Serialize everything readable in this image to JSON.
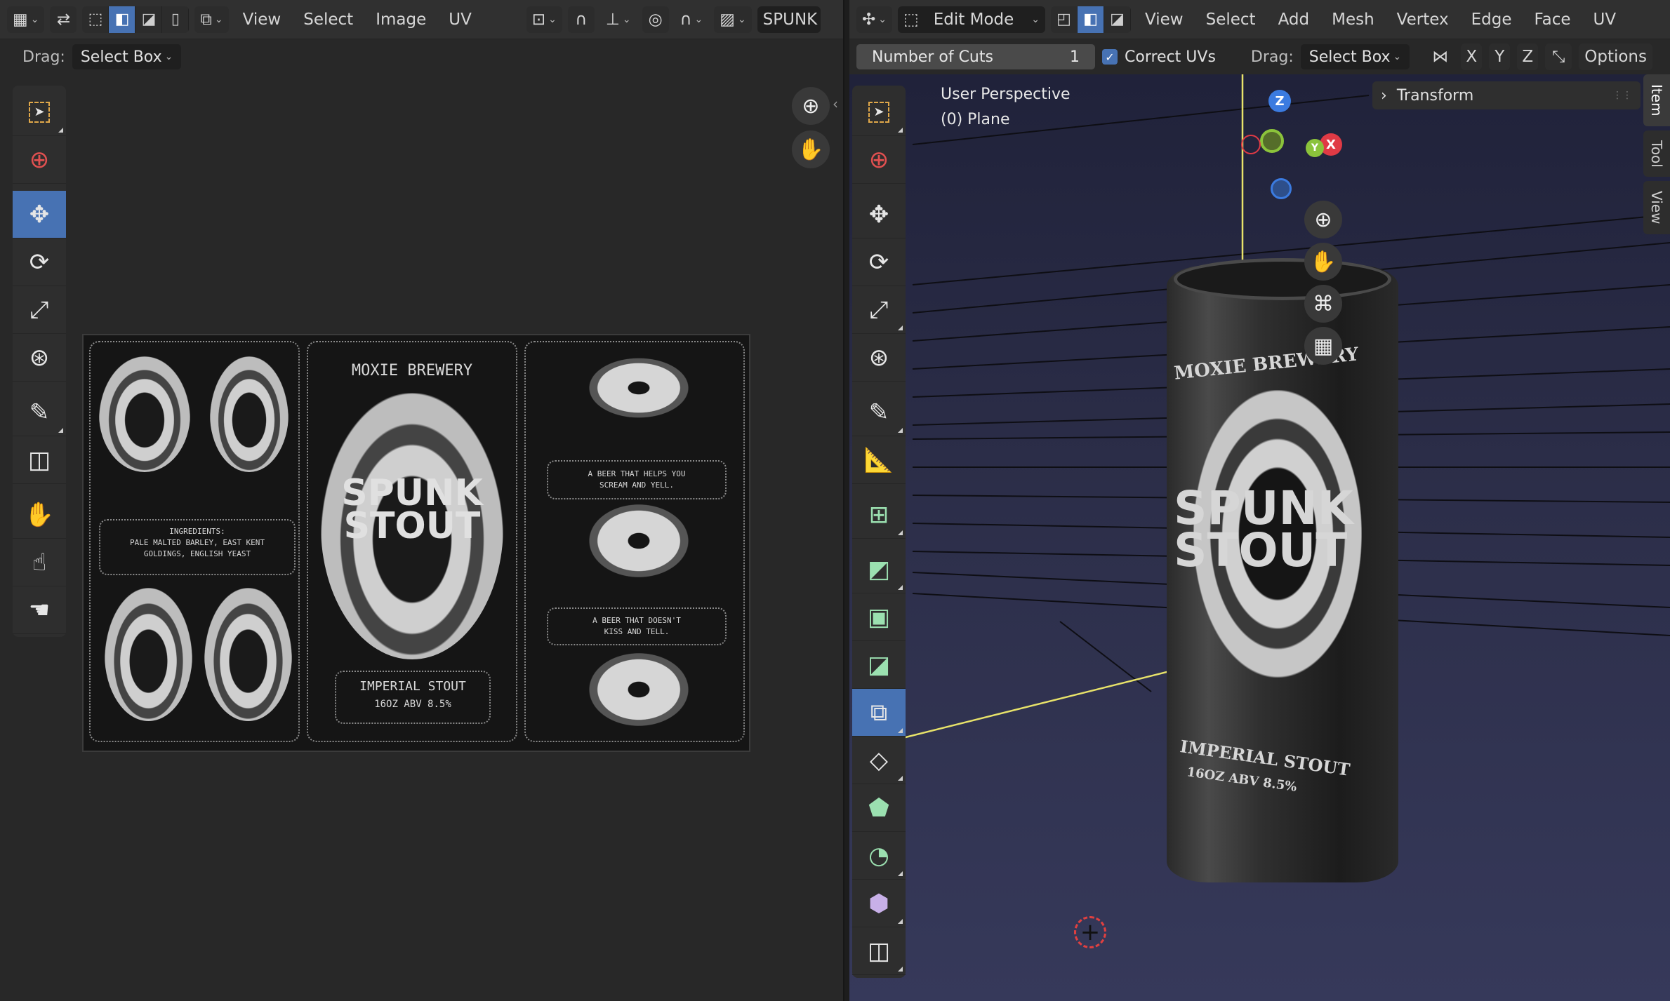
{
  "uv_editor": {
    "menus": [
      "View",
      "Select",
      "Image",
      "UV"
    ],
    "image_name": "SPUNK",
    "drag_label": "Drag:",
    "drag_value": "Select Box"
  },
  "viewport": {
    "mode": "Edit Mode",
    "menus": [
      "View",
      "Select",
      "Add",
      "Mesh",
      "Vertex",
      "Edge",
      "Face",
      "UV"
    ],
    "number_of_cuts_label": "Number of Cuts",
    "number_of_cuts_value": "1",
    "correct_uvs_label": "Correct UVs",
    "correct_uvs_checked": true,
    "drag_label": "Drag:",
    "drag_value": "Select Box",
    "axes": [
      "X",
      "Y",
      "Z"
    ],
    "options_label": "Options",
    "perspective_label": "User Perspective",
    "object_label": "(0) Plane",
    "transform_label": "Transform",
    "sidebar_tabs": [
      "Item",
      "Tool",
      "View"
    ],
    "gizmo": {
      "x": "X",
      "y": "Y",
      "z": "Z"
    }
  },
  "label_art": {
    "brewery": "MOXIE BREWERY",
    "product_line1": "SPUNK",
    "product_line2": "STOUT",
    "ingredients": "INGREDIENTS:\nPALE MALTED BARLEY, EAST KENT\nGOLDINGS, ENGLISH YEAST",
    "style": "IMPERIAL STOUT",
    "abv": "16OZ ABV 8.5%",
    "slogan1": "A BEER THAT HELPS YOU\nSCREAM AND YELL.",
    "slogan2": "A BEER THAT DOESN'T\nKISS AND TELL."
  },
  "can_label": {
    "brewery": "MOXIE BREWERY",
    "product_line1": "SPUNK",
    "product_line2": "STOUT",
    "style": "IMPERIAL STOUT",
    "abv": "16OZ ABV 8.5%"
  },
  "colors": {
    "accent": "#4772b3",
    "x_axis": "#e03a45",
    "y_axis": "#8bc33b",
    "z_axis": "#3b7be0",
    "selection_edge": "#e8e36a"
  }
}
